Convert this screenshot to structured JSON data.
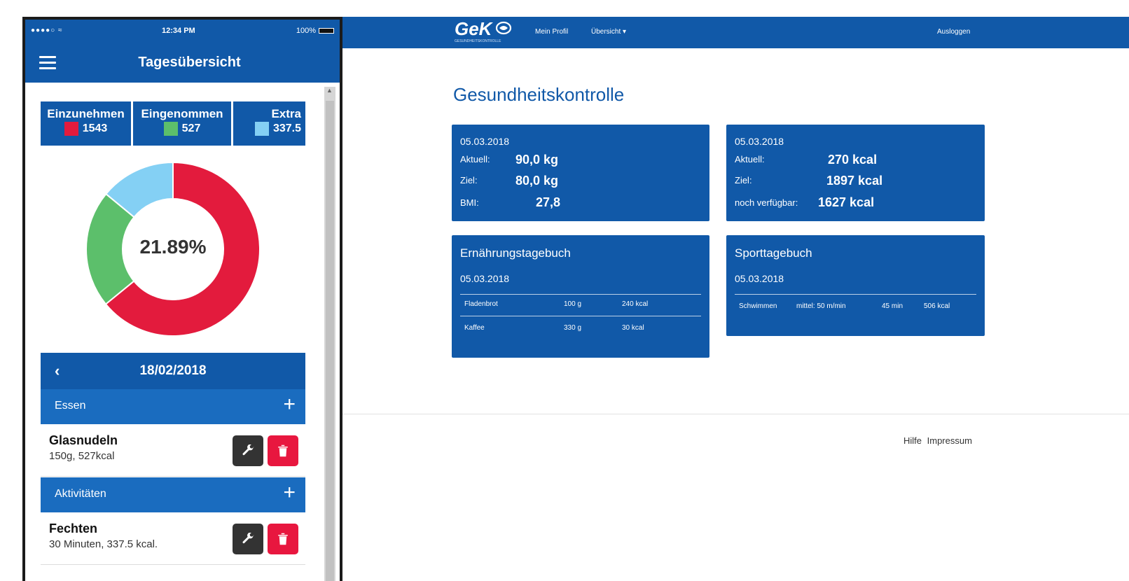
{
  "phone": {
    "status": {
      "signal": "●●●●○ ≈",
      "time": "12:34 PM",
      "battery": "100%"
    },
    "appbar": {
      "title": "Tagesübersicht"
    },
    "stats": [
      {
        "label": "Einzunehmen",
        "value": "1543",
        "color": "#e31b3d"
      },
      {
        "label": "Eingenommen",
        "value": "527",
        "color": "#5cbf6b"
      },
      {
        "label": "Extra",
        "value": "337.5",
        "color": "#84d0f4"
      }
    ],
    "donut": {
      "center_text": "21.89%",
      "segments": [
        {
          "name": "Einzunehmen",
          "value": 1543,
          "color": "#e31b3d"
        },
        {
          "name": "Eingenommen",
          "value": 527,
          "color": "#5cbf6b"
        },
        {
          "name": "Extra",
          "value": 337.5,
          "color": "#84d0f4"
        }
      ]
    },
    "date": "18/02/2018",
    "back_glyph": "‹",
    "essen": {
      "label": "Essen",
      "plus": "+",
      "items": [
        {
          "name": "Glasnudeln",
          "desc": "150g, 527kcal"
        }
      ]
    },
    "aktivitaeten": {
      "label": "Aktivitäten",
      "plus": "+",
      "items": [
        {
          "name": "Fechten",
          "desc": "30 Minuten, 337.5 kcal."
        }
      ]
    }
  },
  "web": {
    "logo": "GeK",
    "logo_sub": "GESUNDHEITSKONTROLLE",
    "nav": {
      "profil": "Mein Profil",
      "uebersicht": "Übersicht ▾",
      "logout": "Ausloggen"
    },
    "title": "Gesundheitskontrolle",
    "weight": {
      "date": "05.03.2018",
      "rows": [
        {
          "label": "Aktuell:",
          "value": "90,0 kg"
        },
        {
          "label": "Ziel:",
          "value": "80,0 kg"
        },
        {
          "label": "BMI:",
          "value": "27,8"
        }
      ]
    },
    "kcal": {
      "date": "05.03.2018",
      "rows": [
        {
          "label": "Aktuell:",
          "value": "270 kcal"
        },
        {
          "label": "Ziel:",
          "value": "1897 kcal"
        },
        {
          "label": "noch verfügbar:",
          "value": "1627 kcal"
        }
      ]
    },
    "ernaehrung": {
      "title": "Ernährungstagebuch",
      "date": "05.03.2018",
      "rows": [
        [
          "Fladenbrot",
          "100 g",
          "240 kcal"
        ],
        [
          "Kaffee",
          "330 g",
          "30 kcal"
        ]
      ]
    },
    "sport": {
      "title": "Sporttagebuch",
      "date": "05.03.2018",
      "rows": [
        [
          "Schwimmen",
          "mittel: 50 m/min",
          "45 min",
          "506 kcal"
        ]
      ]
    },
    "footer": {
      "hilfe": "Hilfe",
      "impressum": "Impressum"
    }
  }
}
